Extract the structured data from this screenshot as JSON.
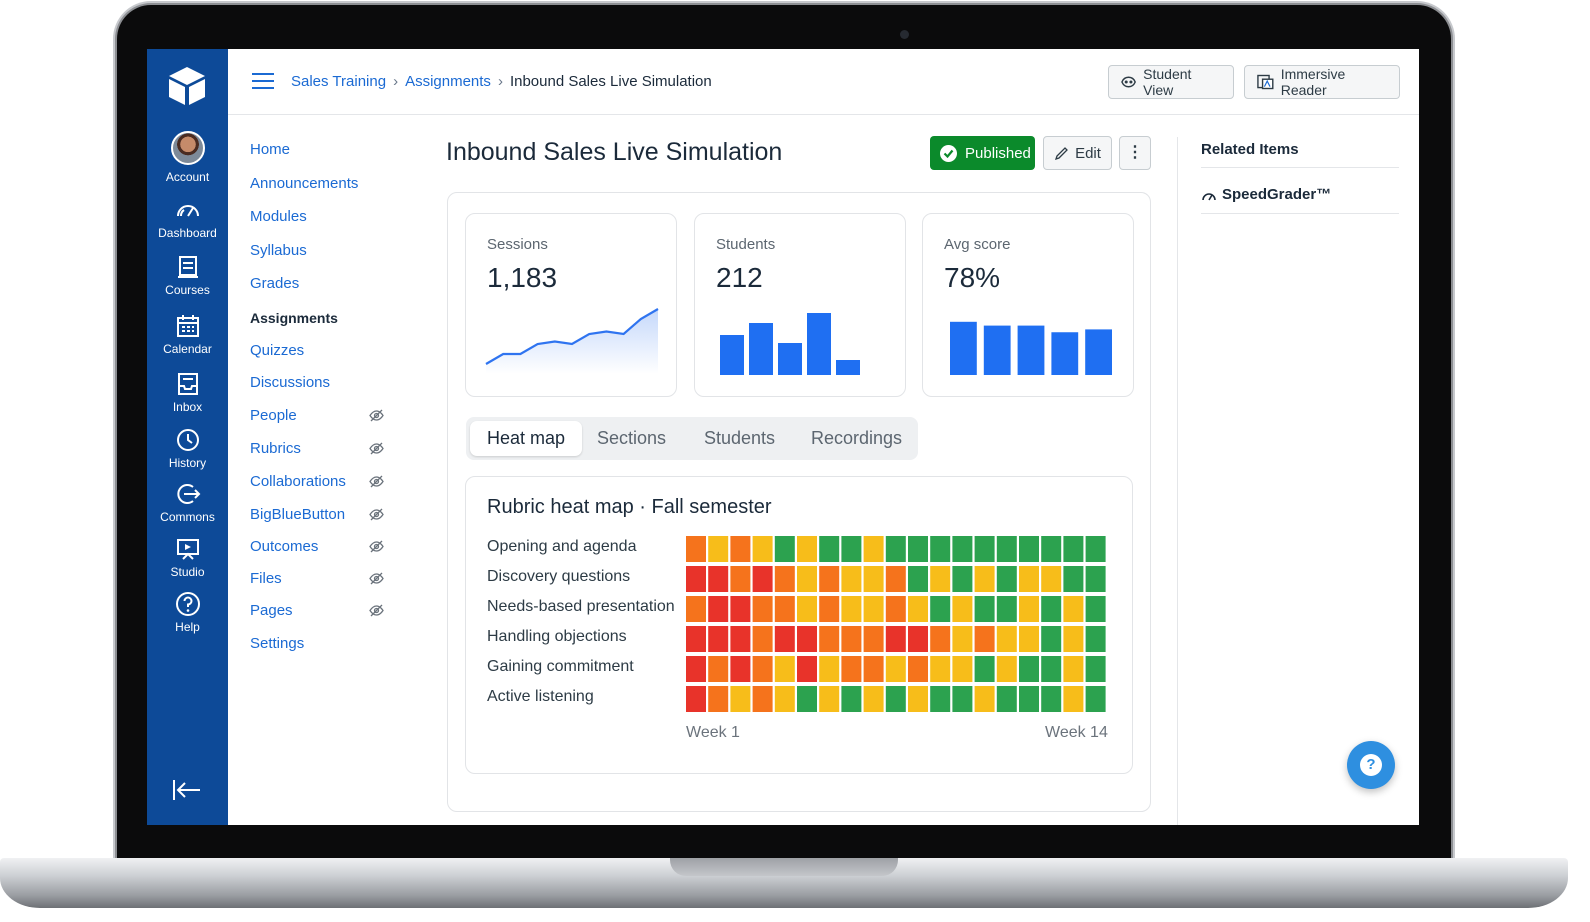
{
  "global_nav": {
    "items": [
      {
        "label": "Account",
        "icon": "avatar"
      },
      {
        "label": "Dashboard",
        "icon": "dashboard-icon"
      },
      {
        "label": "Courses",
        "icon": "courses-icon"
      },
      {
        "label": "Calendar",
        "icon": "calendar-icon"
      },
      {
        "label": "Inbox",
        "icon": "inbox-icon"
      },
      {
        "label": "History",
        "icon": "history-icon"
      },
      {
        "label": "Commons",
        "icon": "commons-icon"
      },
      {
        "label": "Studio",
        "icon": "studio-icon"
      },
      {
        "label": "Help",
        "icon": "help-icon"
      }
    ],
    "logo_icon": "canvas-logo-icon",
    "collapse_icon": "collapse-nav-icon"
  },
  "header": {
    "breadcrumbs": [
      "Sales Training",
      "Assignments",
      "Inbound Sales Live Simulation"
    ],
    "separator": "›",
    "student_view": "Student View",
    "immersive_reader": "Immersive Reader"
  },
  "course_nav": {
    "items": [
      {
        "label": "Home",
        "hidden": false
      },
      {
        "label": "Announcements",
        "hidden": false
      },
      {
        "label": "Modules",
        "hidden": false
      },
      {
        "label": "Syllabus",
        "hidden": false
      },
      {
        "label": "Grades",
        "hidden": false
      },
      {
        "label": "Assignments",
        "hidden": false,
        "active": true
      },
      {
        "label": "Quizzes",
        "hidden": false
      },
      {
        "label": "Discussions",
        "hidden": false
      },
      {
        "label": "People",
        "hidden": true
      },
      {
        "label": "Rubrics",
        "hidden": true
      },
      {
        "label": "Collaborations",
        "hidden": true
      },
      {
        "label": "BigBlueButton",
        "hidden": true
      },
      {
        "label": "Outcomes",
        "hidden": true
      },
      {
        "label": "Files",
        "hidden": true
      },
      {
        "label": "Pages",
        "hidden": true
      },
      {
        "label": "Settings",
        "hidden": false
      }
    ]
  },
  "main": {
    "title": "Inbound Sales Live Simulation",
    "published_label": "Published",
    "edit_label": "Edit",
    "more_label": "⋮",
    "stats": [
      {
        "label": "Sessions",
        "value": "1,183"
      },
      {
        "label": "Students",
        "value": "212"
      },
      {
        "label": "Avg score",
        "value": "78%"
      }
    ],
    "tabs": [
      {
        "label": "Heat map",
        "active": true
      },
      {
        "label": "Sections",
        "active": false
      },
      {
        "label": "Students",
        "active": false
      },
      {
        "label": "Recordings",
        "active": false
      }
    ],
    "heatmap_title": "Rubric heat map · Fall semester",
    "week_start": "Week 1",
    "week_end": "Week 14"
  },
  "related": {
    "heading": "Related Items",
    "speedgrader": "SpeedGrader™"
  },
  "help_fab_label": "?",
  "colors": {
    "nav_blue": "#0d4a98",
    "link_blue": "#1b6ad3",
    "bar_blue": "#1f6ff2",
    "published_green": "#0b8a2b",
    "heat_red": "#e8332a",
    "heat_orange": "#f5731c",
    "heat_yellow": "#f7bd1a",
    "heat_green": "#2ca24f"
  },
  "chart_data": [
    {
      "type": "line",
      "title": "",
      "series": [
        {
          "values": [
            2,
            4,
            4,
            6,
            6.5,
            6,
            8,
            8.5,
            8,
            11,
            13
          ]
        }
      ],
      "ylim": [
        0,
        14
      ]
    },
    {
      "type": "bar",
      "series": [
        {
          "values": [
            40,
            52,
            32,
            62,
            15
          ]
        }
      ],
      "ylim": [
        0,
        65
      ]
    },
    {
      "type": "bar",
      "series": [
        {
          "values": [
            56,
            52,
            52,
            45,
            48
          ]
        }
      ],
      "ylim": [
        0,
        60
      ]
    },
    {
      "type": "heatmap",
      "title": "Rubric heat map · Fall semester",
      "rows": [
        "Opening and agenda",
        "Discovery questions",
        "Needs-based presentation",
        "Handling objections",
        "Gaining commitment",
        "Active listening"
      ],
      "levels_legend": [
        "red",
        "orange",
        "yellow",
        "green"
      ],
      "values": [
        [
          1,
          2,
          1,
          2,
          3,
          2,
          3,
          3,
          2,
          3,
          3,
          3,
          3,
          3,
          3,
          3,
          3,
          3,
          3
        ],
        [
          0,
          0,
          1,
          0,
          1,
          2,
          1,
          2,
          2,
          1,
          3,
          2,
          3,
          2,
          3,
          2,
          2,
          3,
          3
        ],
        [
          1,
          0,
          0,
          1,
          1,
          2,
          1,
          2,
          2,
          1,
          2,
          3,
          2,
          3,
          3,
          2,
          3,
          2,
          3
        ],
        [
          0,
          0,
          0,
          1,
          0,
          0,
          1,
          1,
          1,
          0,
          0,
          1,
          2,
          1,
          2,
          2,
          3,
          2,
          3
        ],
        [
          0,
          1,
          0,
          1,
          2,
          0,
          2,
          1,
          1,
          2,
          1,
          2,
          2,
          3,
          2,
          3,
          3,
          2,
          3
        ],
        [
          0,
          1,
          2,
          1,
          2,
          3,
          2,
          3,
          2,
          3,
          2,
          3,
          3,
          2,
          3,
          3,
          3,
          2,
          3
        ]
      ],
      "x_start_label": "Week 1",
      "x_end_label": "Week 14"
    }
  ]
}
